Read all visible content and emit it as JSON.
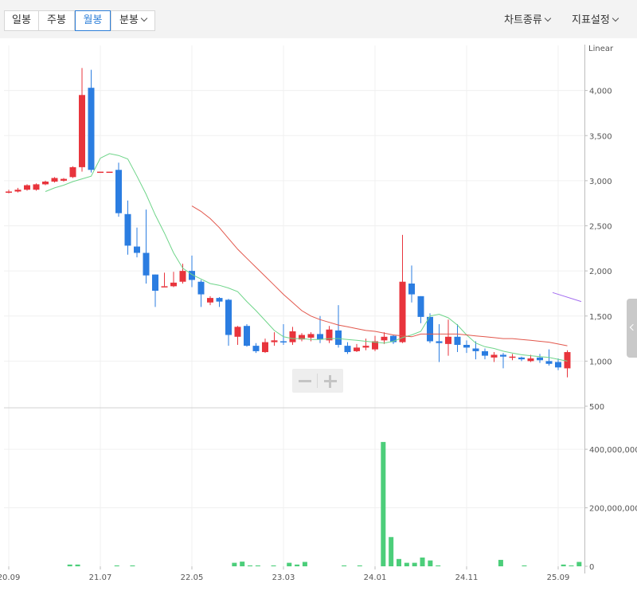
{
  "toolbar": {
    "tabs": [
      {
        "label": "일봉",
        "active": false
      },
      {
        "label": "주봉",
        "active": false
      },
      {
        "label": "월봉",
        "active": true
      },
      {
        "label": "분봉",
        "active": false
      }
    ],
    "chart_type_label": "차트종류",
    "indicator_label": "지표설정"
  },
  "colors": {
    "up": "#e8343c",
    "down": "#2b7de1",
    "volume": "#4cce7a",
    "ma_short": "#6fd58a",
    "ma_long": "#e2574c",
    "ma_extra": "#a36cf0",
    "accent": "#2e7fd8"
  },
  "chart_data": [
    {
      "type": "candlestick",
      "scale_label": "Linear",
      "ylim": [
        500,
        4500
      ],
      "yticks": [
        "500",
        "1,000",
        "1,500",
        "2,000",
        "2,500",
        "3,000",
        "3,500",
        "4,000"
      ],
      "ytick_values": [
        500,
        1000,
        1500,
        2000,
        2500,
        3000,
        3500,
        4000
      ],
      "x_tick_labels": [
        "20.09",
        "21.07",
        "22.05",
        "23.03",
        "24.01",
        "24.11",
        "25.09"
      ],
      "x_tick_index": [
        0,
        10,
        20,
        30,
        40,
        50,
        60
      ],
      "candles": [
        [
          2880,
          2880,
          2900,
          2860
        ],
        [
          2880,
          2900,
          2920,
          2870
        ],
        [
          2900,
          2950,
          2960,
          2890
        ],
        [
          2900,
          2960,
          2970,
          2890
        ],
        [
          2960,
          2990,
          3000,
          2950
        ],
        [
          2990,
          3030,
          3040,
          2980
        ],
        [
          3000,
          3020,
          3030,
          2990
        ],
        [
          3040,
          3150,
          3160,
          3030
        ],
        [
          3150,
          3950,
          4250,
          3100
        ],
        [
          4030,
          3120,
          4230,
          3090
        ],
        [
          3100,
          3100,
          3100,
          3100
        ],
        [
          3100,
          3100,
          3100,
          3100
        ],
        [
          3120,
          2640,
          3200,
          2600
        ],
        [
          2630,
          2280,
          2780,
          2180
        ],
        [
          2270,
          2200,
          2480,
          2150
        ],
        [
          2200,
          1950,
          2680,
          1860
        ],
        [
          1960,
          1780,
          1960,
          1600
        ],
        [
          1830,
          1830,
          1980,
          1830
        ],
        [
          1830,
          1870,
          1990,
          1820
        ],
        [
          1880,
          2000,
          2080,
          1860
        ],
        [
          2000,
          1900,
          2170,
          1820
        ],
        [
          1880,
          1740,
          1900,
          1600
        ],
        [
          1650,
          1700,
          1720,
          1620
        ],
        [
          1700,
          1660,
          1710,
          1600
        ],
        [
          1680,
          1290,
          1690,
          1170
        ],
        [
          1270,
          1380,
          1390,
          1180
        ],
        [
          1390,
          1170,
          1410,
          1160
        ],
        [
          1170,
          1110,
          1200,
          1090
        ],
        [
          1100,
          1210,
          1250,
          1090
        ],
        [
          1210,
          1230,
          1320,
          1170
        ],
        [
          1220,
          1210,
          1410,
          1180
        ],
        [
          1210,
          1330,
          1380,
          1180
        ],
        [
          1240,
          1290,
          1310,
          1220
        ],
        [
          1260,
          1300,
          1320,
          1220
        ],
        [
          1300,
          1240,
          1500,
          1200
        ],
        [
          1230,
          1350,
          1390,
          1200
        ],
        [
          1340,
          1180,
          1620,
          1150
        ],
        [
          1170,
          1100,
          1210,
          1080
        ],
        [
          1110,
          1150,
          1190,
          1100
        ],
        [
          1150,
          1170,
          1250,
          1120
        ],
        [
          1130,
          1220,
          1280,
          1110
        ],
        [
          1230,
          1270,
          1320,
          1190
        ],
        [
          1280,
          1210,
          1290,
          1190
        ],
        [
          1210,
          1880,
          2400,
          1200
        ],
        [
          1860,
          1740,
          2060,
          1650
        ],
        [
          1720,
          1490,
          1720,
          1420
        ],
        [
          1490,
          1220,
          1530,
          1200
        ],
        [
          1220,
          1200,
          1410,
          990
        ],
        [
          1190,
          1270,
          1460,
          1060
        ],
        [
          1270,
          1180,
          1410,
          1100
        ],
        [
          1180,
          1150,
          1230,
          1090
        ],
        [
          1140,
          1110,
          1220,
          1020
        ],
        [
          1110,
          1060,
          1140,
          1020
        ],
        [
          1040,
          1070,
          1100,
          990
        ],
        [
          1070,
          1050,
          1090,
          920
        ],
        [
          1040,
          1050,
          1080,
          1010
        ],
        [
          1040,
          1020,
          1050,
          1000
        ],
        [
          1000,
          1030,
          1070,
          990
        ],
        [
          1040,
          1010,
          1080,
          980
        ],
        [
          1000,
          970,
          1130,
          950
        ],
        [
          990,
          930,
          1030,
          900
        ],
        [
          920,
          1100,
          1120,
          820
        ]
      ],
      "series": [
        {
          "values": [
            null,
            null,
            null,
            null,
            2880,
            2920,
            2950,
            2990,
            3020,
            3050,
            3250,
            3300,
            3280,
            3240,
            3050,
            2850,
            2620,
            2420,
            2200,
            2030,
            1960,
            1910,
            1860,
            1840,
            1810,
            1770,
            1660,
            1560,
            1450,
            1340,
            1270,
            1250,
            1250,
            1240,
            1240,
            1250,
            1250,
            1240,
            1230,
            1220,
            1210,
            1200,
            1220,
            1260,
            1290,
            1330,
            1500,
            1520,
            1480,
            1400,
            1290,
            1200,
            1160,
            1140,
            1110,
            1090,
            1070,
            1060,
            1050,
            1040,
            1020,
            1000
          ]
        },
        {
          "values": [
            null,
            null,
            null,
            null,
            null,
            null,
            null,
            null,
            null,
            null,
            null,
            null,
            null,
            null,
            null,
            null,
            null,
            null,
            null,
            null,
            2720,
            2660,
            2580,
            2480,
            2360,
            2240,
            2140,
            2040,
            1940,
            1840,
            1740,
            1650,
            1560,
            1500,
            1460,
            1430,
            1400,
            1380,
            1360,
            1340,
            1330,
            1310,
            1290,
            1280,
            1270,
            1300,
            1300,
            1300,
            1300,
            1300,
            1290,
            1280,
            1270,
            1260,
            1250,
            1250,
            1240,
            1230,
            1220,
            1210,
            1190,
            1170
          ]
        },
        {
          "values": [
            null,
            null,
            null,
            null,
            null,
            null,
            null,
            null,
            null,
            null,
            null,
            null,
            null,
            null,
            null,
            null,
            null,
            null,
            null,
            null,
            null,
            null,
            null,
            null,
            null,
            null,
            null,
            null,
            null,
            null,
            null,
            null,
            null,
            null,
            null,
            null,
            null,
            null,
            null,
            null,
            null,
            null,
            null,
            null,
            null,
            null,
            null,
            null,
            null,
            null,
            null,
            null,
            null,
            null,
            null,
            null,
            null,
            null,
            null,
            null,
            1760,
            1660
          ]
        }
      ]
    },
    {
      "type": "bar",
      "ylim": [
        0,
        520000000
      ],
      "yticks": [
        "0",
        "200,000,000",
        "400,000,000"
      ],
      "ytick_values": [
        0,
        200000000,
        400000000
      ],
      "values": [
        0,
        0,
        0,
        0,
        0,
        0,
        0,
        0,
        6000000,
        6000000,
        0,
        0,
        0,
        0,
        3000000,
        0,
        3000000,
        0,
        0,
        0,
        0,
        0,
        0,
        0,
        0,
        0,
        0,
        0,
        0,
        12000000,
        16000000,
        3000000,
        3000000,
        0,
        3000000,
        0,
        12000000,
        6000000,
        15000000,
        0,
        0,
        0,
        0,
        3000000,
        0,
        3000000,
        0,
        0,
        425000000,
        100000000,
        25000000,
        12000000,
        12000000,
        30000000,
        20000000,
        3000000,
        0,
        0,
        0,
        0,
        0,
        0,
        0,
        22000000,
        0,
        0,
        3000000,
        0,
        0,
        0,
        0,
        6000000,
        3000000,
        15000000
      ]
    }
  ]
}
